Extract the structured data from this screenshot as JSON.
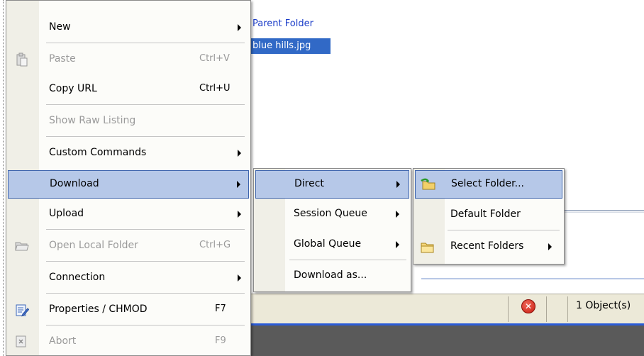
{
  "pane": {
    "parent_folder": "Parent Folder",
    "selected_file": "blue hills.jpg"
  },
  "status": {
    "objects": "1 Object(s)",
    "error_glyph": "✕"
  },
  "main_menu": {
    "items": [
      {
        "label": "New",
        "shortcut": "",
        "submenu": true,
        "disabled": false
      },
      {
        "label": "Paste",
        "shortcut": "Ctrl+V",
        "submenu": false,
        "disabled": true
      },
      {
        "label": "Copy URL",
        "shortcut": "Ctrl+U",
        "submenu": false,
        "disabled": false
      },
      {
        "label": "Show Raw Listing",
        "shortcut": "",
        "submenu": false,
        "disabled": true
      },
      {
        "label": "Custom Commands",
        "shortcut": "",
        "submenu": true,
        "disabled": false
      },
      {
        "label": "Download",
        "shortcut": "",
        "submenu": true,
        "disabled": false,
        "highlighted": true
      },
      {
        "label": "Upload",
        "shortcut": "",
        "submenu": true,
        "disabled": false
      },
      {
        "label": "Open Local Folder",
        "shortcut": "Ctrl+G",
        "submenu": false,
        "disabled": true
      },
      {
        "label": "Connection",
        "shortcut": "",
        "submenu": true,
        "disabled": false
      },
      {
        "label": "Properties / CHMOD",
        "shortcut": "F7",
        "submenu": false,
        "disabled": false
      },
      {
        "label": "Abort",
        "shortcut": "F9",
        "submenu": false,
        "disabled": true
      }
    ]
  },
  "download_menu": {
    "items": [
      {
        "label": "Direct",
        "submenu": true,
        "highlighted": true
      },
      {
        "label": "Session Queue",
        "submenu": true
      },
      {
        "label": "Global Queue",
        "submenu": true
      },
      {
        "label": "Download as...",
        "submenu": false
      }
    ]
  },
  "direct_menu": {
    "items": [
      {
        "label": "Select Folder...",
        "highlighted": true
      },
      {
        "label": "Default Folder"
      },
      {
        "label": "Recent Folders",
        "submenu": true
      }
    ]
  },
  "colors": {
    "highlight_bg": "#b6c8e8",
    "highlight_border": "#3d64ad",
    "selection": "#3169c6",
    "link_blue": "#1a3cc8",
    "disabled": "#9a9a9a"
  }
}
